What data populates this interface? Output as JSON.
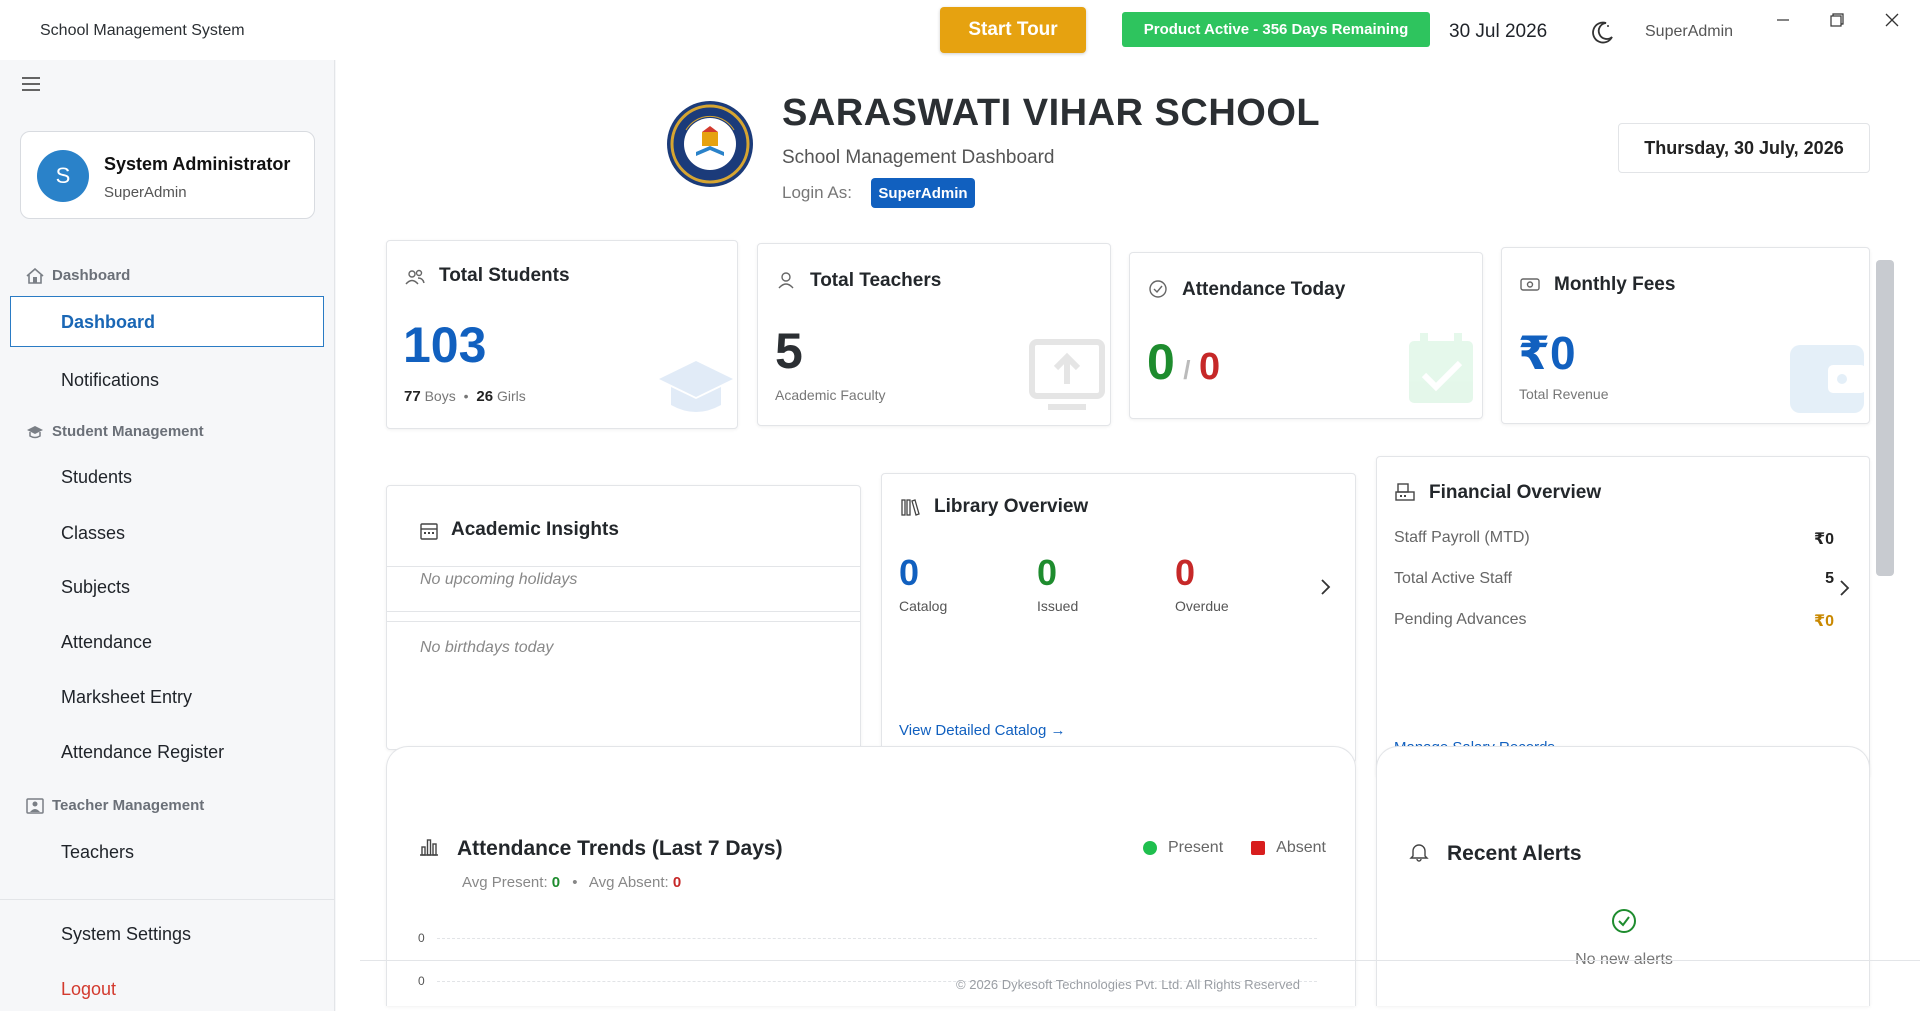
{
  "titlebar": {
    "app_title": "School Management System",
    "start_tour": "Start Tour",
    "license": "Product Active - 356 Days Remaining",
    "date": "30 Jul 2026",
    "user": "SuperAdmin"
  },
  "sidebar": {
    "profile": {
      "initial": "S",
      "name": "System Administrator",
      "role": "SuperAdmin"
    },
    "sections": {
      "dashboard": "Dashboard",
      "student_mgmt": "Student Management",
      "teacher_mgmt": "Teacher Management"
    },
    "items": {
      "dashboard": "Dashboard",
      "notifications": "Notifications",
      "students": "Students",
      "classes": "Classes",
      "subjects": "Subjects",
      "attendance": "Attendance",
      "marksheet": "Marksheet Entry",
      "attendance_register": "Attendance Register",
      "teachers": "Teachers",
      "settings": "System Settings",
      "logout": "Logout"
    }
  },
  "header": {
    "school_name": "SARASWATI VIHAR SCHOOL",
    "subtitle": "School Management Dashboard",
    "login_as_label": "Login As:",
    "login_as_value": "SuperAdmin",
    "full_date": "Thursday, 30 July, 2026"
  },
  "stats": {
    "students": {
      "title": "Total Students",
      "value": "103",
      "boys": "77",
      "boys_label": "Boys",
      "sep": "•",
      "girls": "26",
      "girls_label": "Girls"
    },
    "teachers": {
      "title": "Total Teachers",
      "value": "5",
      "sub": "Academic Faculty"
    },
    "attendance": {
      "title": "Attendance Today",
      "present": "0",
      "sep": "/",
      "absent": "0"
    },
    "fees": {
      "title": "Monthly Fees",
      "value": "₹0",
      "sub": "Total Revenue"
    }
  },
  "academic": {
    "title": "Academic Insights",
    "holidays": "No upcoming holidays",
    "birthdays": "No birthdays today"
  },
  "library": {
    "title": "Library Overview",
    "catalog": "0",
    "catalog_label": "Catalog",
    "issued": "0",
    "issued_label": "Issued",
    "overdue": "0",
    "overdue_label": "Overdue",
    "link": "View Detailed Catalog →"
  },
  "financial": {
    "title": "Financial Overview",
    "rows": [
      {
        "label": "Staff Payroll (MTD)",
        "value": "₹0"
      },
      {
        "label": "Total Active Staff",
        "value": "5"
      },
      {
        "label": "Pending Advances",
        "value": "₹0"
      }
    ],
    "link": "Manage Salary Records →"
  },
  "trends": {
    "title": "Attendance Trends (Last 7 Days)",
    "legend_present": "Present",
    "legend_absent": "Absent",
    "avg_present_label": "Avg Present:",
    "avg_present": "0",
    "sep": "•",
    "avg_absent_label": "Avg Absent:",
    "avg_absent": "0",
    "tick_a": "0",
    "tick_b": "0"
  },
  "alerts": {
    "title": "Recent Alerts",
    "empty": "No new alerts"
  },
  "footer": "© 2026 Dykesoft Technologies Pvt. Ltd. All Rights Reserved",
  "colors": {
    "accent_blue": "#1160bf",
    "present_green": "#1e8c2e",
    "absent_red": "#c62828",
    "tour_orange": "#e6a210",
    "license_green": "#2ec45e",
    "logout_red": "#d33a2e"
  }
}
